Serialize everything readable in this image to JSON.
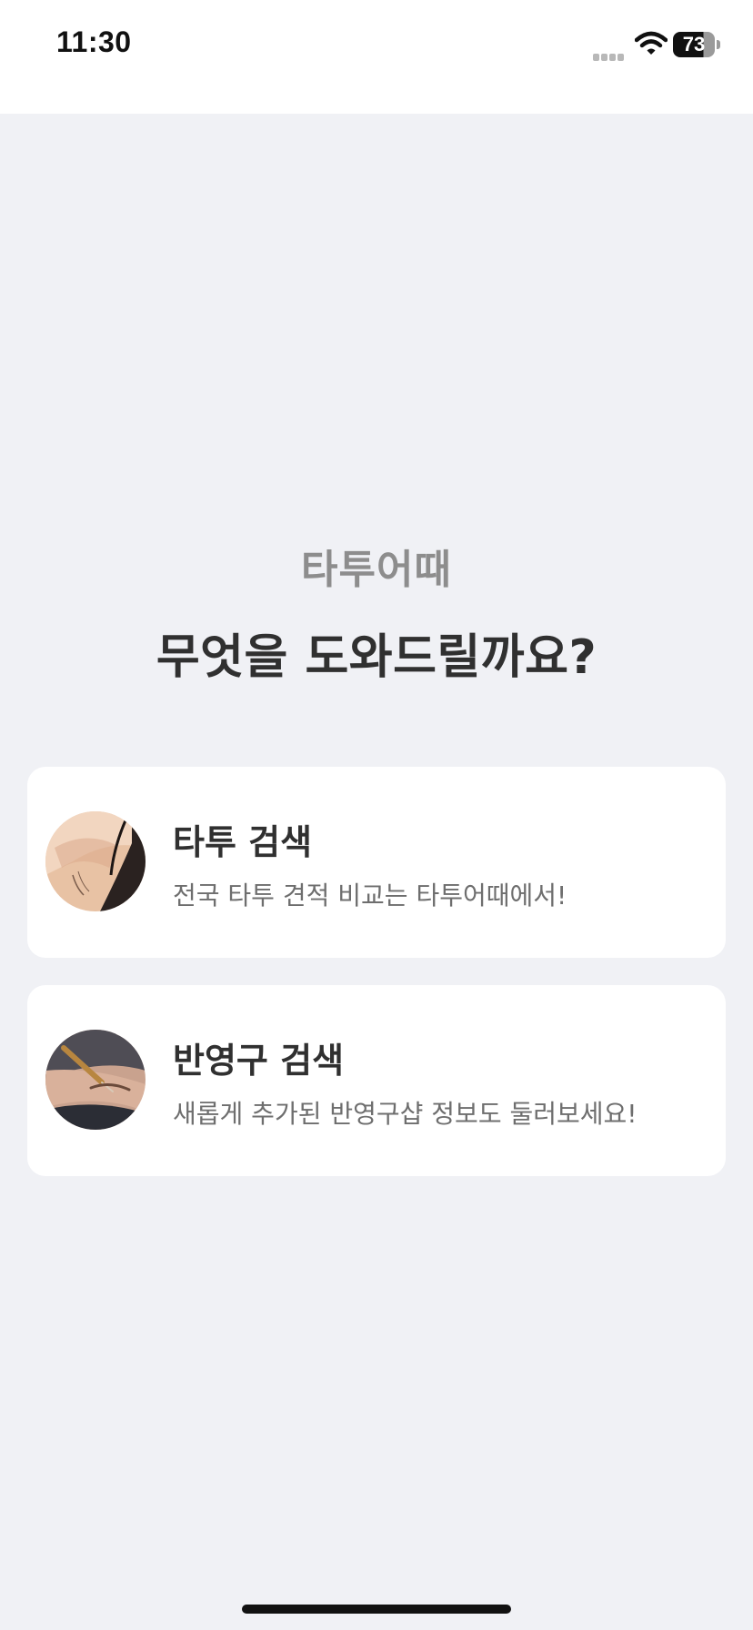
{
  "status_bar": {
    "time": "11:30",
    "battery_level": "73",
    "signal_icon": "cellular-signal-icon",
    "wifi_icon": "wifi-icon",
    "battery_icon": "battery-icon"
  },
  "main": {
    "brand": "타투어때",
    "heading": "무엇을 도와드릴까요?"
  },
  "cards": [
    {
      "title": "타투 검색",
      "description": "전국 타투 견적 비교는 타투어때에서!",
      "image": "tattoo-photo"
    },
    {
      "title": "반영구 검색",
      "description": "새롭게 추가된 반영구샵 정보도 둘러보세요!",
      "image": "semi-permanent-makeup-photo"
    }
  ],
  "colors": {
    "background": "#f0f1f5",
    "card": "#ffffff",
    "brand_text": "#8d8d8d",
    "heading_text": "#303030",
    "description_text": "#6e6e6e"
  }
}
